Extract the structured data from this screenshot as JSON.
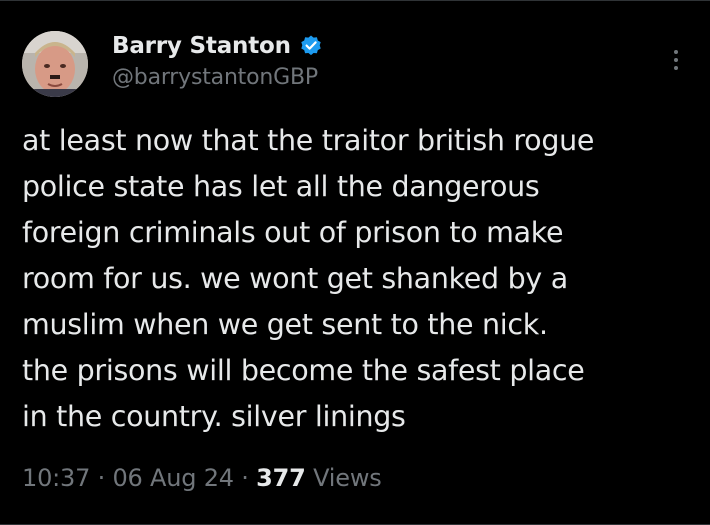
{
  "author": {
    "display_name": "Barry Stanton",
    "handle": "@barrystantonGBP",
    "verified": true,
    "verified_color": "#1d9bf0"
  },
  "tweet": {
    "lines": [
      "at least now that the traitor british rogue",
      "police state has let all the dangerous",
      "foreign criminals out of prison to make",
      "room for us. we wont get shanked by a",
      "muslim when we get sent to the nick.",
      "the prisons will become the safest place",
      "in the country. silver linings"
    ]
  },
  "meta": {
    "time": "10:37",
    "separator": " · ",
    "date": "06 Aug 24",
    "views_count": "377",
    "views_label": " Views"
  },
  "colors": {
    "background": "#000000",
    "primary_text": "#e7e9ea",
    "secondary_text": "#71767b"
  }
}
